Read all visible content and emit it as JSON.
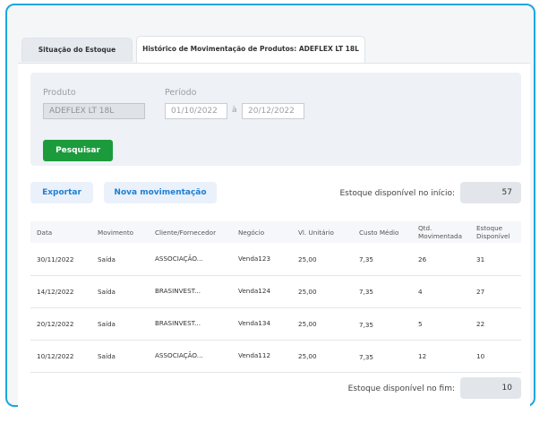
{
  "tabs": [
    {
      "label": "Situação do Estoque"
    },
    {
      "label": "Histórico de Movimentação de Produtos: ADEFLEX LT 18L"
    }
  ],
  "filters": {
    "product_label": "Produto",
    "product_value": "ADEFLEX LT 18L",
    "period_label": "Período",
    "date_from": "01/10/2022",
    "date_sep": "à",
    "date_to": "20/12/2022",
    "search_label": "Pesquisar"
  },
  "actions": {
    "export_label": "Exportar",
    "new_label": "Nova movimentação"
  },
  "stock_start": {
    "label": "Estoque disponível no início:",
    "value": "57"
  },
  "stock_end": {
    "label": "Estoque disponível no fim:",
    "value": "10"
  },
  "table": {
    "headers": {
      "date": "Data",
      "movement": "Movimento",
      "client": "Cliente/Fornecedor",
      "deal": "Negócio",
      "unit_value": "Vl. Unitário",
      "avg_cost": "Custo Médio",
      "qty_1": "Qtd.",
      "qty_2": "Movimentada",
      "stock_1": "Estoque",
      "stock_2": "Disponível"
    },
    "rows": [
      {
        "date": "30/11/2022",
        "movement": "Saída",
        "client": "ASSOCIAÇÃO...",
        "deal": "Venda123",
        "unit_value": "25,00",
        "avg_cost": "7,35",
        "qty": "26",
        "stock": "31"
      },
      {
        "date": "14/12/2022",
        "movement": "Saída",
        "client": "BRASINVEST...",
        "deal": "Venda124",
        "unit_value": "25,00",
        "avg_cost": "7,35",
        "qty": "4",
        "stock": "27"
      },
      {
        "date": "20/12/2022",
        "movement": "Saída",
        "client": "BRASINVEST...",
        "deal": "Venda134",
        "unit_value": "25,00",
        "avg_cost": "7,35",
        "qty": "5",
        "stock": "22"
      },
      {
        "date": "10/12/2022",
        "movement": "Saída",
        "client": "ASSOCIAÇÃO...",
        "deal": "Venda112",
        "unit_value": "25,00",
        "avg_cost": "7,35",
        "qty": "12",
        "stock": "10"
      }
    ]
  },
  "colors": {
    "frame": "#19a7e0",
    "accent_green": "#1c9b3d",
    "link_blue": "#1f7fd1"
  }
}
